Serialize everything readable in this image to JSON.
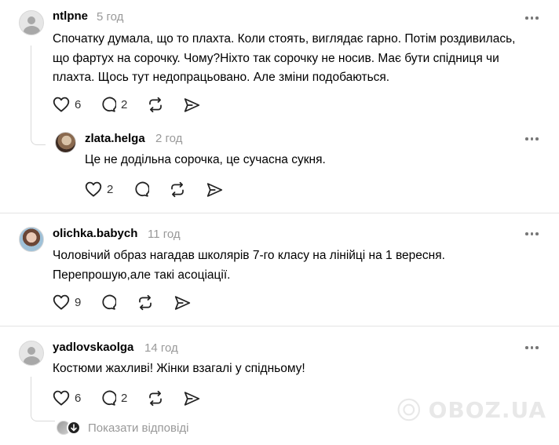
{
  "comments": [
    {
      "username": "ntlpne",
      "time": "5 год",
      "text": "Спочатку думала, що то плахта. Коли стоять, виглядає гарно. Потім роздивилась, що фартух на сорочку. Чому?Ніхто так сорочку не носив. Має бути спідниця чи плахта. Щось тут недопрацьовано. Але зміни подобаються.",
      "likes": "6",
      "replies_count": "2",
      "avatar_icon": "default-avatar-icon"
    },
    {
      "username": "zlata.helga",
      "time": "2 год",
      "text": "Це не додільна сорочка, це сучасна сукня.",
      "likes": "2",
      "avatar_icon": "user-photo-avatar"
    },
    {
      "username": "olichka.babych",
      "time": "11 год",
      "text": "Чоловічий образ нагадав школярів 7-го класу на лінійці на 1 вересня. Перепрошую,але такі асоціації.",
      "likes": "9",
      "avatar_icon": "user-photo-avatar"
    },
    {
      "username": "yadlovskaolga",
      "time": "14 год",
      "text": "Костюми жахливі! Жінки взагалі у спідньому!",
      "likes": "6",
      "replies_count": "2",
      "avatar_icon": "default-avatar-icon",
      "show_replies": "Показати відповіді"
    }
  ],
  "icons": {
    "like": "heart-icon",
    "comment": "comment-bubble-icon",
    "repost": "repost-icon",
    "share": "send-icon",
    "more": "more-horizontal-icon"
  },
  "watermark": "OBOZ.UA"
}
